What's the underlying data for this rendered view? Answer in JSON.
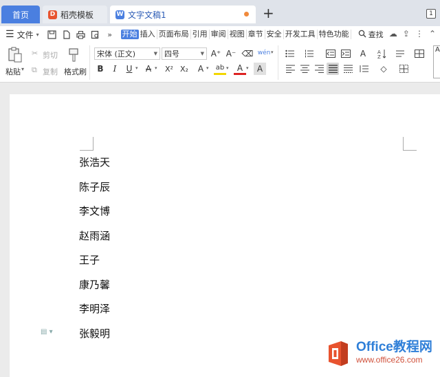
{
  "tabs": {
    "home": "首页",
    "template": "稻壳模板",
    "document": "文字文稿1",
    "template_icon": "D",
    "document_icon": "W",
    "new_tab": "+",
    "tab_count": "1"
  },
  "menubar": {
    "file": "文件",
    "more": "»",
    "tabs": [
      "开始",
      "插入",
      "页面布局",
      "引用",
      "审阅",
      "视图",
      "章节",
      "安全",
      "开发工具",
      "特色功能"
    ],
    "search": "查找"
  },
  "ribbon": {
    "paste": "粘贴",
    "cut": "剪切",
    "copy": "复制",
    "format_painter": "格式刷",
    "font_name": "宋体 (正文)",
    "font_size": "四号",
    "grow_font": "A⁺",
    "shrink_font": "A⁻",
    "clear_format": "⌫",
    "pinyin": "wén",
    "bold": "B",
    "italic": "I",
    "underline": "U",
    "strikethrough": "A",
    "superscript": "X²",
    "subscript": "X₂",
    "text_effect": "A",
    "highlight": "ab",
    "font_color": "A",
    "char_shading": "A",
    "right_clip": "A"
  },
  "document": {
    "names": [
      "张浩天",
      "陈子辰",
      "李文博",
      "赵雨涵",
      "王子",
      "康乃馨",
      "李明泽",
      "张毅明"
    ]
  },
  "watermark": {
    "title_latin": "Office",
    "title_zh": "教程网",
    "url": "www.office26.com"
  },
  "colors": {
    "accent": "#4a7fe0",
    "watermark_blue": "#2f7fd8",
    "watermark_red": "#d0503a"
  }
}
